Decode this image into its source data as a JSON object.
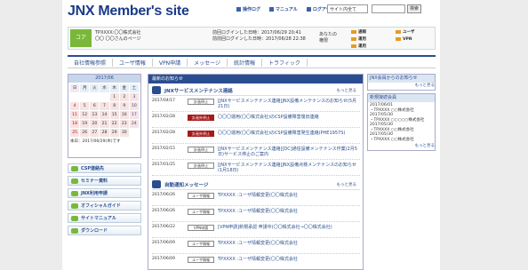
{
  "header": {
    "logo": "JNX Member's site",
    "links": [
      "操作ログ",
      "マニュアル",
      "ログアウト"
    ],
    "select_value": "サイト内全て",
    "search_button": "検索"
  },
  "user": {
    "badge": "コア",
    "company": "TPXXXX:〇〇株式会社",
    "name": "〇〇 〇〇さんのページ",
    "last_login": "前回ログインした日時：2017/06/29 20:41",
    "prev_login": "前前回ログインした日時：2017/06/28 22:38",
    "rights_label_1": "あなたの",
    "rights_label_2": "権限",
    "rights": [
      "通報",
      "ユーザ",
      "運用",
      "VPN",
      "運用"
    ]
  },
  "nav": [
    "自社情報参照",
    "ユーザ情報",
    "VPN申請",
    "メッセージ",
    "統計情報",
    "トラフィック"
  ],
  "calendar": {
    "title": "2017/06",
    "days": [
      "日",
      "月",
      "火",
      "水",
      "木",
      "金",
      "土"
    ],
    "dates": [
      "",
      "",
      "",
      "",
      "1",
      "2",
      "3",
      "4",
      "5",
      "6",
      "7",
      "8",
      "9",
      "10",
      "11",
      "12",
      "13",
      "14",
      "15",
      "16",
      "17",
      "18",
      "19",
      "20",
      "21",
      "22",
      "23",
      "24",
      "25",
      "26",
      "27",
      "28",
      "29",
      "30",
      ""
    ],
    "today": "本日：2017/06/29(木)です"
  },
  "menu": [
    "CSP連絡先",
    "セミナー資料",
    "JNX利用申請",
    "オフィシャルガイド",
    "サイトマニュアル",
    "ダウンロード"
  ],
  "main": {
    "title": "最新のお知らせ",
    "sec1_title": "JNXサービスメンテナンス連絡",
    "sec1_more": "もっと見る",
    "sec1_rows": [
      {
        "date": "2017/04/17",
        "tag": "計画停止",
        "red": false,
        "text": "[JNXサービスメンテナンス連絡]JNX設備メンテナンスのお知らせ(5月21日)"
      },
      {
        "date": "2017/02/28",
        "tag": "計画外停止",
        "red": true,
        "text": "〇〇〇運用(〇〇株式会社)のCSP設備障害復旧連絡"
      },
      {
        "date": "2017/02/28",
        "tag": "計画外停止",
        "red": true,
        "text": "〇〇〇運用(〇〇株式会社)のCSP設備障害発生連絡(PHE1957S)"
      },
      {
        "date": "2017/02/15",
        "tag": "計画停止",
        "red": false,
        "text": "[JNXサービスメンテナンス連絡][DC]通信設備メンテナンス作業(2月5日)サービス停止のご案内"
      },
      {
        "date": "2017/01/25",
        "tag": "計画停止",
        "red": false,
        "text": "[JNXサービスメンテナンス連絡]JNX設備点検メンテナンスのお知らせ(1月18日)"
      }
    ],
    "sec2_title": "自動通知メッセージ",
    "sec2_more": "もっと見る",
    "sec2_rows": [
      {
        "date": "2017/06/26",
        "tag": "ユーザ情報",
        "text": "TPXXXX :ユーザ情報変更(〇〇株式会社"
      },
      {
        "date": "2017/06/26",
        "tag": "ユーザ情報",
        "text": "TPXXXX :ユーザ情報変更(〇〇株式会社"
      },
      {
        "date": "2017/06/22",
        "tag": "VPN申請",
        "text": "[VPN申請]新規承認 申請中(〇〇株式会社→〇〇株式会社)"
      },
      {
        "date": "2017/06/09",
        "tag": "ユーザ情報",
        "text": "TPXXXX :ユーザ情報変更(〇〇株式会社"
      },
      {
        "date": "2017/06/09",
        "tag": "ユーザ情報",
        "text": "TPXXXX :ユーザ情報変更(〇〇株式会社"
      }
    ]
  },
  "right": {
    "box1_title": "JNX会員からのお知らせ",
    "box1_more": "もっと見る",
    "box2_title": "新規接続会員",
    "box2_items": [
      "2017/06/01",
      "・TPXXXX ○○株式会社",
      "2017/05/30",
      "・TPXXXX ○○○○○株式会社",
      "2017/05/30",
      "・TPXXXX ○○株式会社",
      "2017/05/30",
      "・TPXXXX ○○株式会社"
    ],
    "box2_more": "もっと見る"
  }
}
